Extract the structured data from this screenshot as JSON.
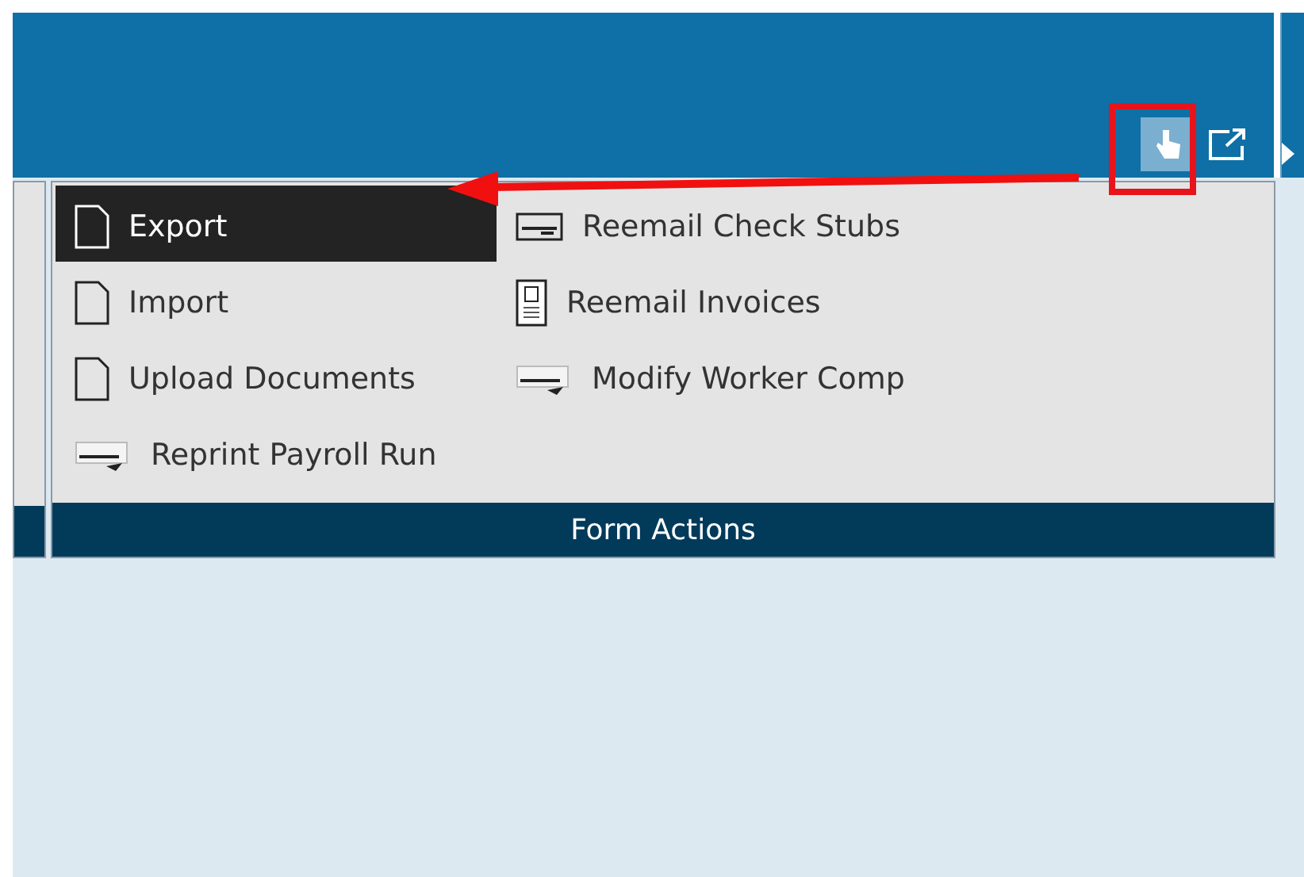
{
  "toolbar": {
    "buttons": [
      {
        "kind": "hand",
        "selected": true
      },
      {
        "kind": "popout",
        "selected": false
      }
    ]
  },
  "ribbon": {
    "group": {
      "label": "Form Actions",
      "columns": [
        [
          {
            "label": "Export",
            "kind": "page",
            "selected": true
          },
          {
            "label": "Import",
            "kind": "page",
            "selected": false
          },
          {
            "label": "Upload Documents",
            "kind": "page",
            "selected": false
          },
          {
            "label": "Reprint Payroll Run",
            "kind": "cheque",
            "selected": false
          }
        ],
        [
          {
            "label": "Reemail Check Stubs",
            "kind": "stub",
            "selected": false
          },
          {
            "label": "Reemail Invoices",
            "kind": "invoice",
            "selected": false
          },
          {
            "label": "Modify Worker Comp",
            "kind": "cheque",
            "selected": false
          }
        ]
      ]
    }
  }
}
